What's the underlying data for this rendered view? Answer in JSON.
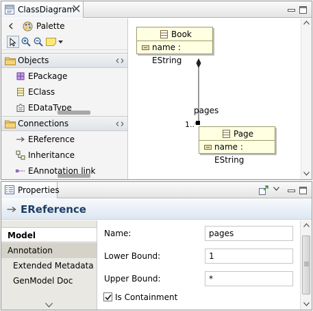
{
  "editor": {
    "tab_title": "ClassDiagram",
    "palette": {
      "title": "Palette",
      "drawers": [
        {
          "label": "Objects",
          "items": [
            {
              "label": "EPackage",
              "icon": "epackage-icon"
            },
            {
              "label": "EClass",
              "icon": "eclass-icon"
            },
            {
              "label": "EDataType",
              "icon": "edatatype-icon"
            }
          ]
        },
        {
          "label": "Connections",
          "items": [
            {
              "label": "EReference",
              "icon": "ereference-icon"
            },
            {
              "label": "Inheritance",
              "icon": "inheritance-icon"
            },
            {
              "label": "EAnnotation link",
              "icon": "eannotation-link-icon"
            }
          ]
        }
      ]
    },
    "diagram": {
      "classes": [
        {
          "name": "Book",
          "attribute": "name : EString"
        },
        {
          "name": "Page",
          "attribute": "name : EString"
        }
      ],
      "reference": {
        "name": "pages",
        "multiplicity": "1..*"
      }
    }
  },
  "properties": {
    "tab_title": "Properties",
    "selection_title": "EReference",
    "sections": [
      "Model",
      "Annotation",
      "Extended Metadata",
      "GenModel Doc"
    ],
    "selected_section": "Model",
    "fields": {
      "name_label": "Name:",
      "name_value": "pages",
      "lower_label": "Lower Bound:",
      "lower_value": "1",
      "upper_label": "Upper Bound:",
      "upper_value": "*",
      "containment_label": "Is Containment",
      "containment_checked": true
    }
  },
  "colors": {
    "class_fill": "#ffffe2",
    "title_text": "#1d3e66",
    "selection_tab": "#d4d2c9"
  }
}
